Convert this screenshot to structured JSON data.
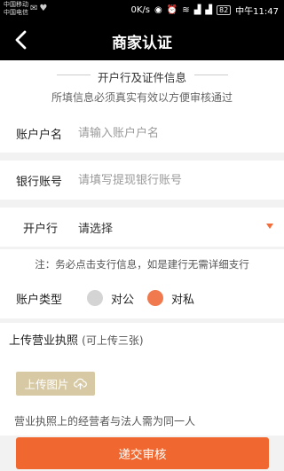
{
  "status_bar": {
    "carrier_1": "中国移动",
    "carrier_2": "中国电信",
    "network_speed": "0K/s",
    "battery": "82",
    "time": "中午11:47"
  },
  "header": {
    "title": "商家认证"
  },
  "section": {
    "title": "开户行及证件信息",
    "subtitle": "所填信息必须真实有效以方便审核通过"
  },
  "fields": {
    "account_name": {
      "label": "账户户名",
      "value": "",
      "placeholder": "请输入账户户名"
    },
    "bank_account": {
      "label": "银行账号",
      "value": "",
      "placeholder": "请填写提现银行账号"
    },
    "bank": {
      "label": "开户行",
      "value": "请选择"
    }
  },
  "notice": "注：务必点击支行信息，如是建行无需详细支行",
  "account_type": {
    "label": "账户类型",
    "options": [
      {
        "label": "对公",
        "selected": false,
        "color": "#d4d4d4"
      },
      {
        "label": "对私",
        "selected": true,
        "color": "#f07a4e"
      }
    ]
  },
  "upload": {
    "title": "上传营业执照",
    "hint": "(可上传三张)",
    "button_label": "上传图片",
    "note": "营业执照上的经营者与法人需为同一人"
  },
  "submit": {
    "label": "递交审核",
    "color": "#f0682f"
  }
}
